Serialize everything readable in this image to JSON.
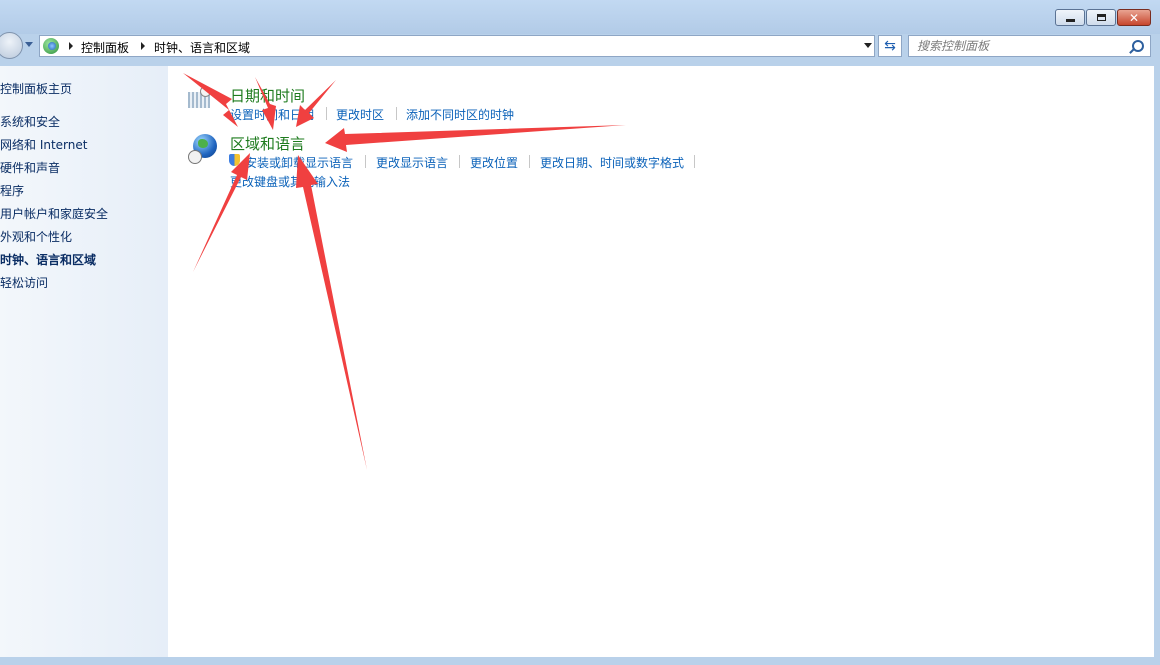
{
  "window": {
    "buttons": {
      "minimize": "minimize",
      "maximize": "maximize",
      "close": "close"
    }
  },
  "nav": {
    "breadcrumb": [
      "控制面板",
      "时钟、语言和区域"
    ],
    "search_placeholder": "搜索控制面板"
  },
  "sidebar": {
    "items": [
      {
        "label": "控制面板主页",
        "bold": false
      },
      {
        "label": "系统和安全",
        "bold": false
      },
      {
        "label": "网络和 Internet",
        "bold": false
      },
      {
        "label": "硬件和声音",
        "bold": false
      },
      {
        "label": "程序",
        "bold": false
      },
      {
        "label": "用户帐户和家庭安全",
        "bold": false
      },
      {
        "label": "外观和个性化",
        "bold": false
      },
      {
        "label": "时钟、语言和区域",
        "bold": true
      },
      {
        "label": "轻松访问",
        "bold": false
      }
    ]
  },
  "categories": [
    {
      "title": "日期和时间",
      "icon": "calendar-clock-icon",
      "links": [
        "设置时间和日期",
        "更改时区",
        "添加不同时区的时钟"
      ]
    },
    {
      "title": "区域和语言",
      "icon": "globe-clock-icon",
      "links": [
        "安装或卸载显示语言",
        "更改显示语言",
        "更改位置",
        "更改日期、时间或数字格式",
        "更改键盘或其他输入法"
      ]
    }
  ],
  "colors": {
    "category_title": "#1e7b1e",
    "link": "#0b62b9",
    "annotation_arrow": "#f04040"
  }
}
